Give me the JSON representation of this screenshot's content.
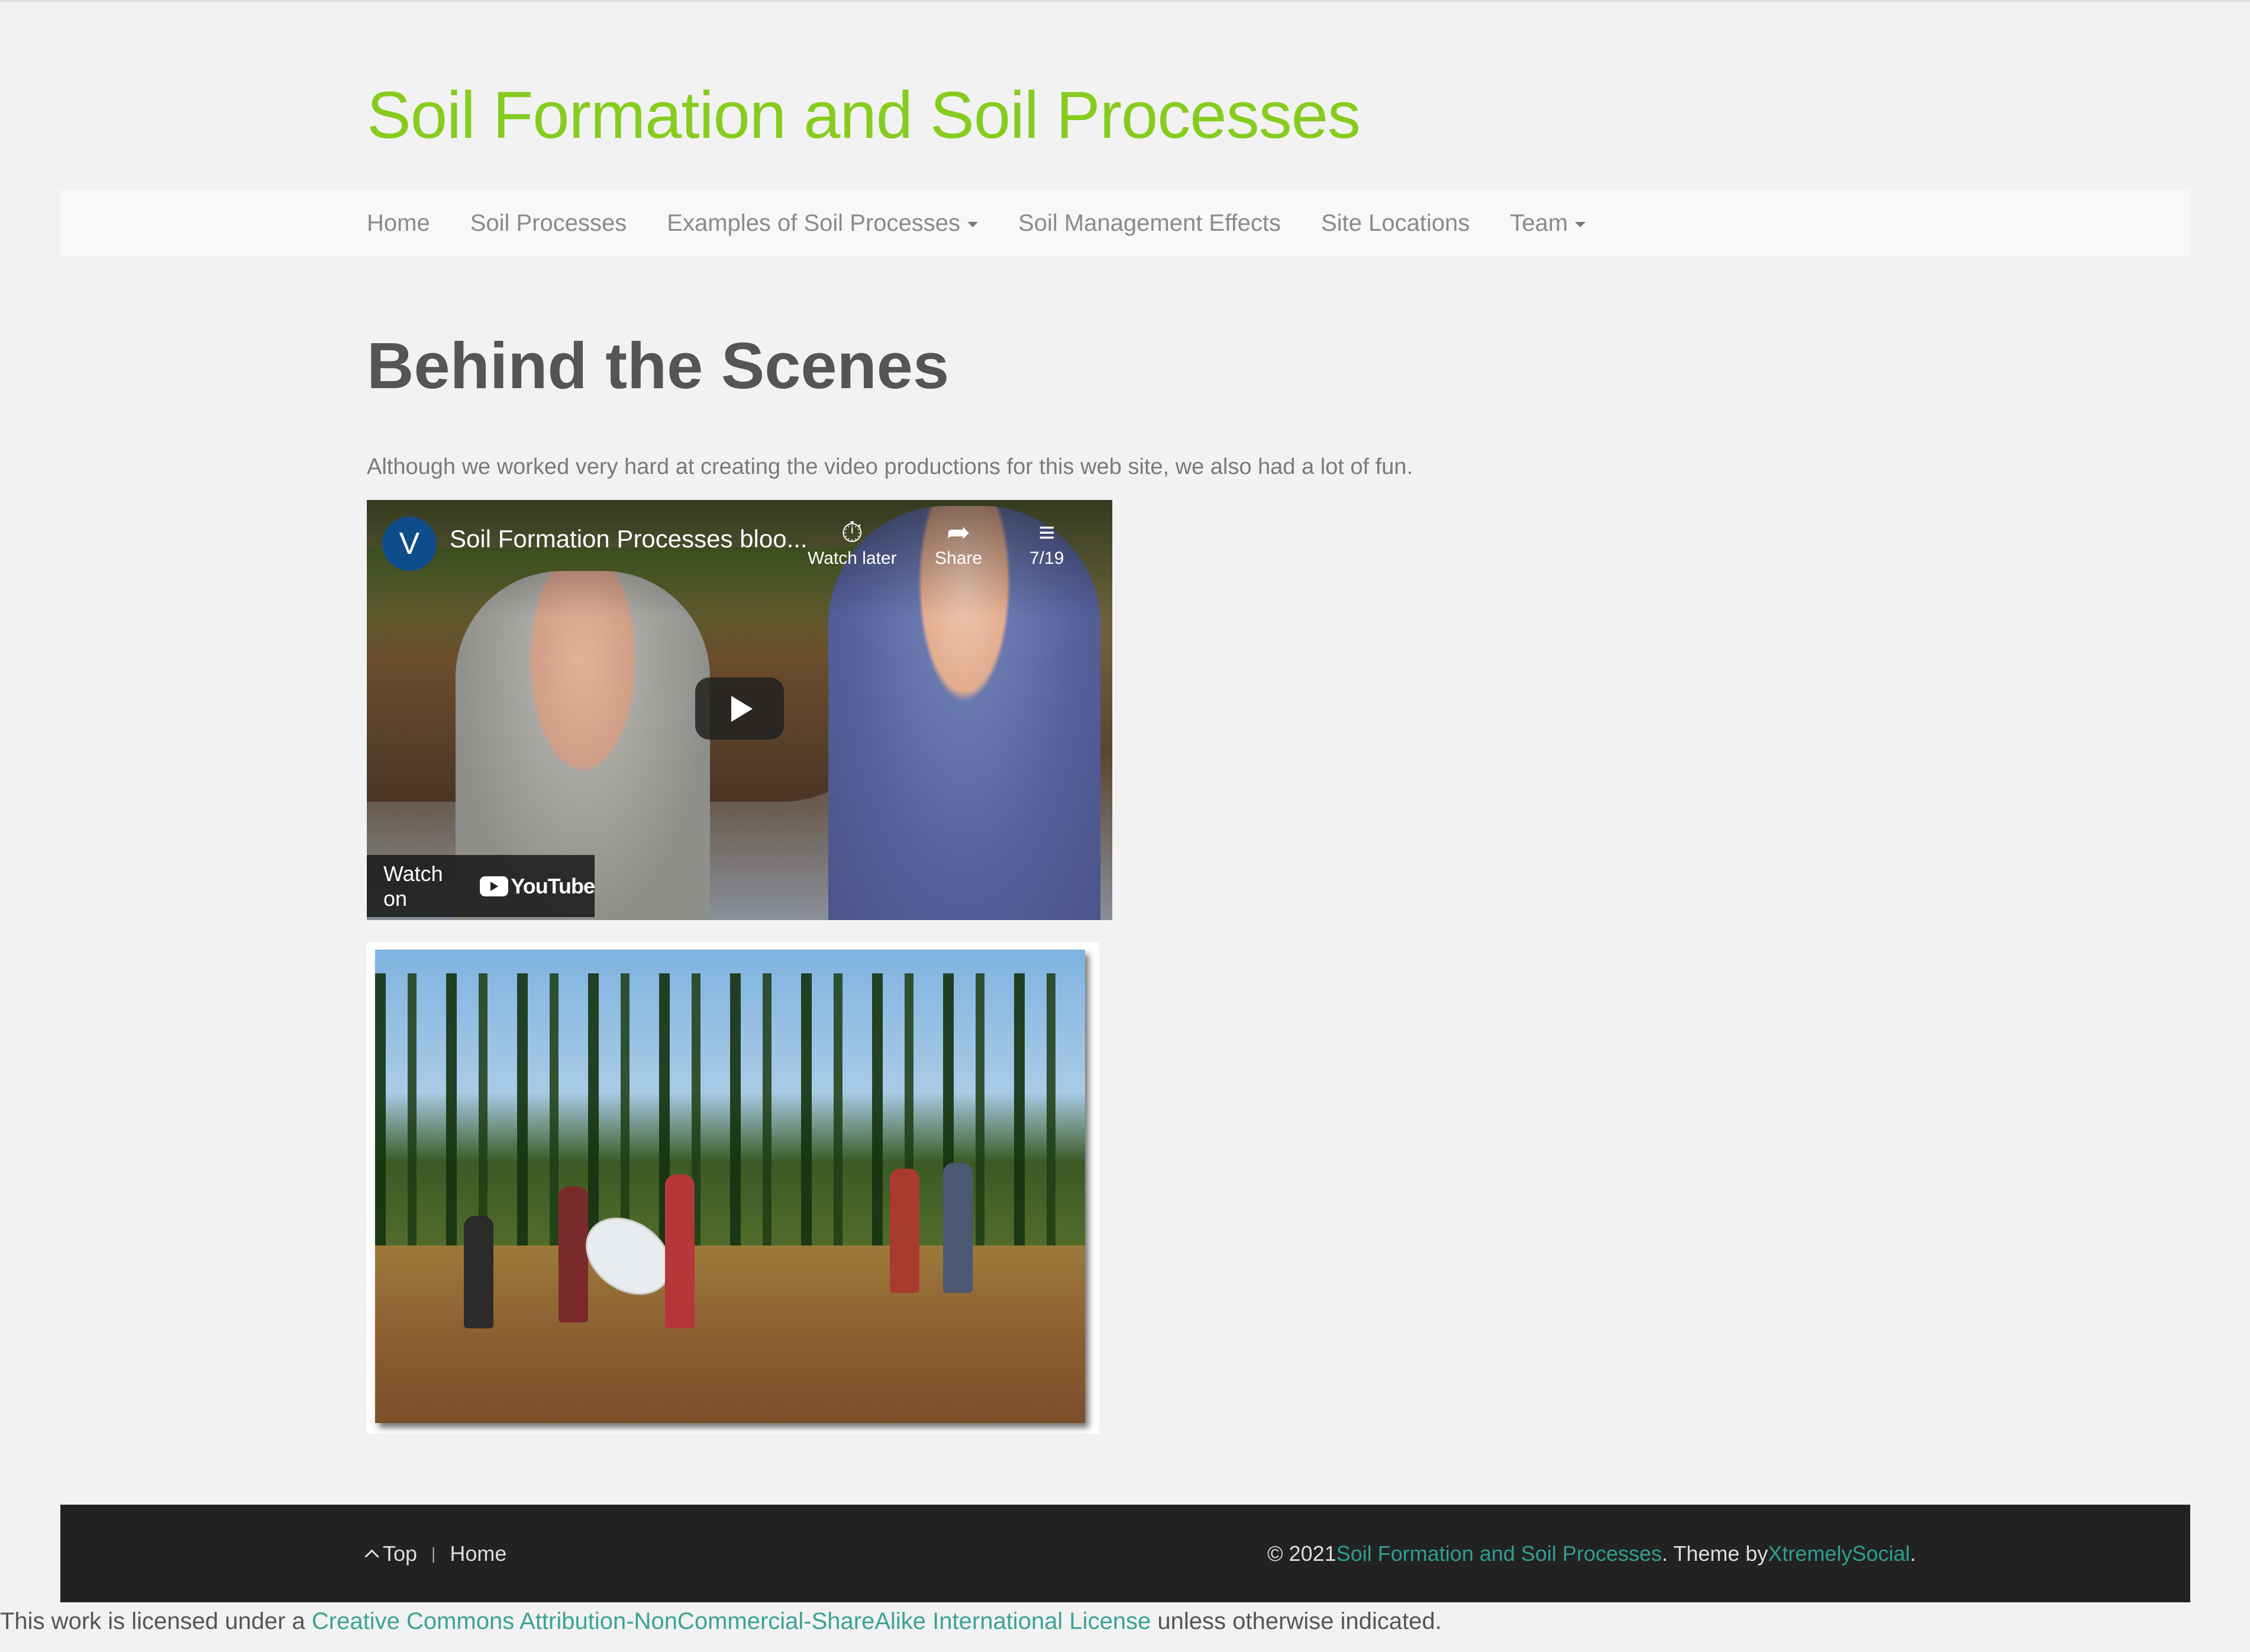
{
  "site": {
    "title": "Soil Formation and Soil Processes"
  },
  "nav": {
    "items": [
      {
        "label": "Home",
        "dropdown": false
      },
      {
        "label": "Soil Processes",
        "dropdown": false
      },
      {
        "label": "Examples of Soil Processes",
        "dropdown": true
      },
      {
        "label": "Soil Management Effects",
        "dropdown": false
      },
      {
        "label": "Site Locations",
        "dropdown": false
      },
      {
        "label": "Team",
        "dropdown": true
      }
    ]
  },
  "page": {
    "heading": "Behind the Scenes",
    "intro": "Although we worked very hard at creating the video productions for this web site, we also had a lot of fun."
  },
  "video": {
    "channel_initial": "V",
    "title": "Soil Formation Processes bloo...",
    "watch_later": "Watch later",
    "share": "Share",
    "playlist_count": "7/19",
    "watch_on": "Watch on",
    "youtube": "YouTube"
  },
  "footer": {
    "top": "Top",
    "home": "Home",
    "copyright_prefix": "© 2021 ",
    "site_link": "Soil Formation and Soil Processes",
    "theme_by": ". Theme by ",
    "theme_link": "XtremelySocial",
    "end": "."
  },
  "license": {
    "prefix": "This work is licensed under a ",
    "link": "Creative Commons Attribution-NonCommercial-ShareAlike International License",
    "suffix": " unless otherwise indicated."
  },
  "colors": {
    "title_green": "#86cc1e",
    "link_teal": "#2f9e8f",
    "footer_bg": "#222222"
  }
}
